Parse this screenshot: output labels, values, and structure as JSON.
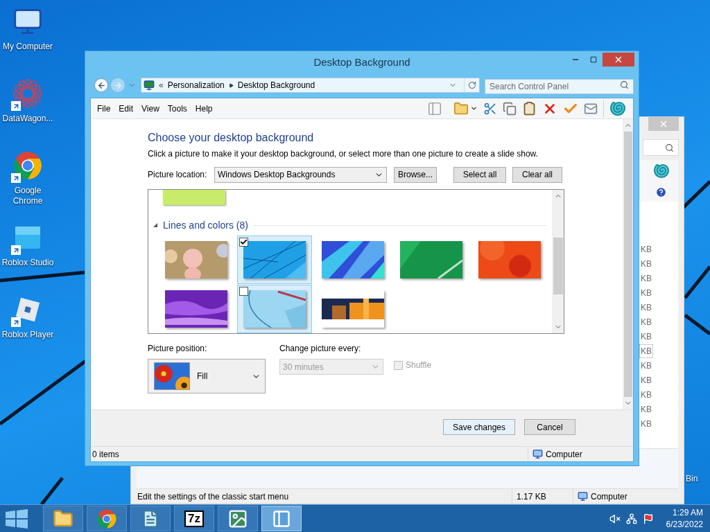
{
  "desktop": {
    "icons": [
      {
        "kind": "computer",
        "label": "My Computer",
        "shortcut": false
      },
      {
        "kind": "datawagon",
        "label": "DataWagon...",
        "shortcut": true
      },
      {
        "kind": "chrome",
        "label": "Google Chrome",
        "shortcut": true
      },
      {
        "kind": "studio",
        "label": "Roblox Studio",
        "shortcut": true
      },
      {
        "kind": "player",
        "label": "Roblox Player",
        "shortcut": true
      }
    ],
    "partial_label": "Bin"
  },
  "back_window": {
    "rows": [
      {
        "size": "KB",
        "focused": false
      },
      {
        "size": "KB",
        "focused": false
      },
      {
        "size": "KB",
        "focused": false
      },
      {
        "size": "KB",
        "focused": false
      },
      {
        "size": "KB",
        "focused": false
      },
      {
        "size": "KB",
        "focused": false
      },
      {
        "size": "KB",
        "focused": false
      },
      {
        "size": "KB",
        "focused": true
      },
      {
        "size": "KB",
        "focused": false
      },
      {
        "size": "KB",
        "focused": false
      },
      {
        "size": "KB",
        "focused": false
      },
      {
        "size": "KB",
        "focused": false
      },
      {
        "size": "KB",
        "focused": false
      }
    ],
    "status_bar": {
      "description": "Edit the settings of the classic start menu",
      "size": "1.17 KB",
      "location": "Computer"
    }
  },
  "window": {
    "title": "Desktop Background",
    "address": {
      "overflow": "«",
      "crumbs": [
        "Personalization",
        "Desktop Background"
      ]
    },
    "search": {
      "placeholder": "Search Control Panel"
    },
    "menu": [
      "File",
      "Edit",
      "View",
      "Tools",
      "Help"
    ],
    "heading": "Choose your desktop background",
    "instructions": "Click a picture to make it your desktop background, or select more than one picture to create a slide show.",
    "picture_location": {
      "label": "Picture location:",
      "value": "Windows Desktop Backgrounds"
    },
    "location_buttons": [
      "Browse...",
      "Select all",
      "Clear all"
    ],
    "group": {
      "title": "Lines and colors (8)",
      "expanded": true,
      "pictures": [
        {
          "highlighted": false,
          "checked": false
        },
        {
          "highlighted": true,
          "checked": true
        },
        {
          "highlighted": false,
          "checked": false
        },
        {
          "highlighted": false,
          "checked": false
        },
        {
          "highlighted": false,
          "checked": false
        },
        {
          "highlighted": false,
          "checked": false
        },
        {
          "highlighted": true,
          "checked": false
        },
        {
          "highlighted": false,
          "checked": false
        }
      ]
    },
    "picture_position": {
      "label": "Picture position:",
      "value": "Fill"
    },
    "change_picture": {
      "label": "Change picture every:",
      "value": "30 minutes",
      "disabled": true
    },
    "shuffle": {
      "label": "Shuffle",
      "checked": false,
      "disabled": true
    },
    "footer_buttons": [
      {
        "label": "Save changes",
        "default": true
      },
      {
        "label": "Cancel",
        "default": false
      }
    ],
    "status_bar": {
      "items": "0 items",
      "location": "Computer"
    }
  },
  "taskbar": {
    "buttons": [
      {
        "kind": "folder",
        "selected": false
      },
      {
        "kind": "chrome",
        "selected": false
      },
      {
        "kind": "notepad",
        "selected": false
      },
      {
        "kind": "sevenzip",
        "glyph": "7z",
        "selected": false
      },
      {
        "kind": "picture",
        "selected": false
      },
      {
        "kind": "control",
        "selected": true
      }
    ],
    "clock": {
      "time": "1:29 AM",
      "date": "6/23/2022"
    }
  }
}
